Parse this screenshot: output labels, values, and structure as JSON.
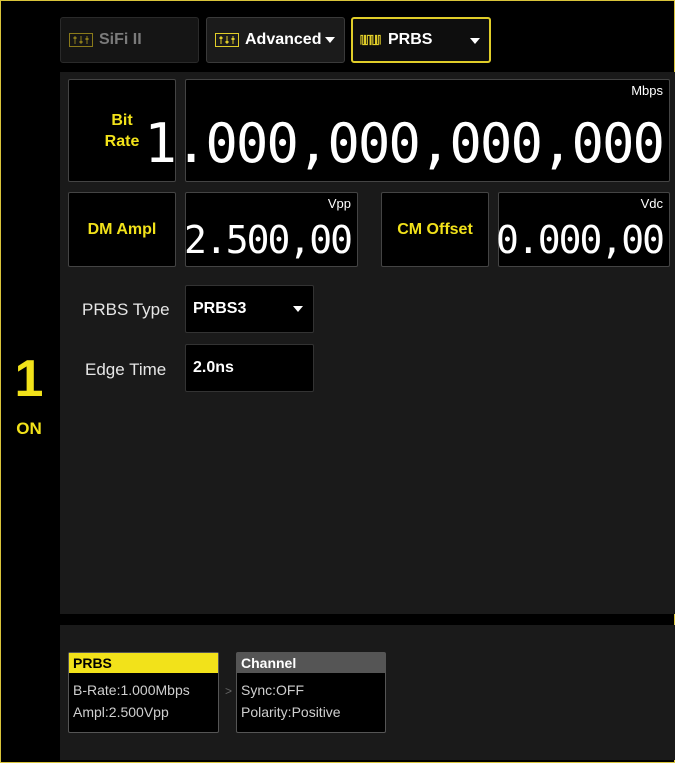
{
  "channel": {
    "number": "1",
    "state": "ON"
  },
  "tabs": {
    "sifi": "SiFi II",
    "advanced": "Advanced",
    "prbs": "PRBS"
  },
  "bit_rate": {
    "label_line1": "Bit",
    "label_line2": "Rate",
    "value": "1.000,000,000,000",
    "unit": "Mbps"
  },
  "dm_ampl": {
    "label": "DM Ampl",
    "value": "2.500,00",
    "unit": "Vpp"
  },
  "cm_offset": {
    "label": "CM Offset",
    "value": "0.000,00",
    "unit": "Vdc"
  },
  "prbs_type": {
    "label": "PRBS Type",
    "value": "PRBS3"
  },
  "edge_time": {
    "label": "Edge Time",
    "value": "2.0ns"
  },
  "summary": {
    "prbs_card": {
      "title": "PRBS",
      "line1": "B-Rate:1.000Mbps",
      "line2": "Ampl:2.500Vpp"
    },
    "separator": ">",
    "channel_card": {
      "title": "Channel",
      "line1": "Sync:OFF",
      "line2": "Polarity:Positive"
    }
  },
  "colors": {
    "accent": "#f2e21a",
    "panel": "#1a1a1a",
    "background": "#000000"
  }
}
